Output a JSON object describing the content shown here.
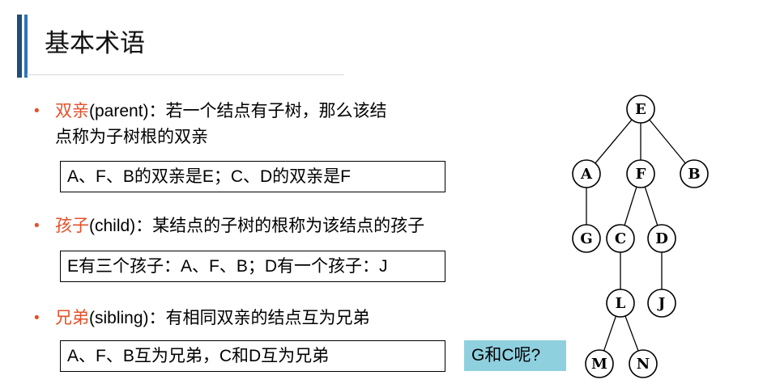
{
  "title": "基本术语",
  "bullets": [
    {
      "term": "双亲",
      "rest_line1": "(parent)：若一个结点有子树，那么该结",
      "line2": "点称为子树根的双亲",
      "example": "A、F、B的双亲是E；C、D的双亲是F"
    },
    {
      "term": "孩子",
      "rest_line1": "(child)：某结点的子树的根称为该结点的孩子",
      "line2": "",
      "example": "E有三个孩子：A、F、B；D有一个孩子：J"
    },
    {
      "term": "兄弟",
      "rest_line1": "(sibling)：有相同双亲的结点互为兄弟",
      "line2": "",
      "example": "A、F、B互为兄弟，C和D互为兄弟"
    }
  ],
  "question": "G和C呢?",
  "bullet_symbol": "•",
  "colors": {
    "accent": "#e4502a",
    "title_bar": "#2e75b6",
    "question_bg": "#8fd0df"
  },
  "tree": {
    "nodes": [
      "E",
      "A",
      "F",
      "B",
      "G",
      "C",
      "D",
      "L",
      "J",
      "M",
      "N"
    ],
    "edges": [
      [
        "E",
        "A"
      ],
      [
        "E",
        "F"
      ],
      [
        "E",
        "B"
      ],
      [
        "A",
        "G"
      ],
      [
        "F",
        "C"
      ],
      [
        "F",
        "D"
      ],
      [
        "C",
        "L"
      ],
      [
        "D",
        "J"
      ],
      [
        "L",
        "M"
      ],
      [
        "L",
        "N"
      ]
    ]
  }
}
